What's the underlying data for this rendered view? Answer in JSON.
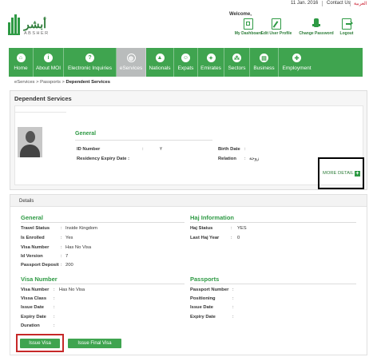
{
  "topbar": {
    "date": "11 Jan. 2016",
    "contact": "Contact Us",
    "language": "العربية"
  },
  "logo": {
    "arabic": "أبشر",
    "english": "ABSHER"
  },
  "welcome": {
    "label": "Welcome,",
    "actions": [
      {
        "label": "My Dashboard",
        "icon": "dashboard-icon"
      },
      {
        "label": "Edit User Profile",
        "icon": "edit-profile-icon"
      },
      {
        "label": "Change Password",
        "icon": "change-password-icon"
      },
      {
        "label": "Logout",
        "icon": "logout-icon"
      }
    ]
  },
  "nav": {
    "items": [
      {
        "label": "Home",
        "icon": "home-icon"
      },
      {
        "label": "About MOI",
        "icon": "about-icon"
      },
      {
        "label": "Electronic Inquiries",
        "icon": "inquiries-icon"
      },
      {
        "label": "eServices",
        "icon": "globe-icon",
        "active": true
      },
      {
        "label": "Nationals",
        "icon": "nationals-icon"
      },
      {
        "label": "Expats",
        "icon": "expats-icon"
      },
      {
        "label": "Emirates",
        "icon": "emirates-icon"
      },
      {
        "label": "Sectors",
        "icon": "sectors-icon"
      },
      {
        "label": "Business",
        "icon": "business-icon"
      },
      {
        "label": "Employment",
        "icon": "employment-icon"
      }
    ]
  },
  "breadcrumb": {
    "items": [
      "eServices",
      "Passports"
    ],
    "current": "Dependent Services",
    "separator": ">"
  },
  "dependent": {
    "title": "Dependent Services",
    "general_title": "General",
    "id_number_label": "ID Number",
    "id_number_value": "٢",
    "residency_label": "Residency Expiry Date :",
    "birth_date_label": "Birth Date",
    "relation_label": "Relation",
    "relation_value": "زوجة",
    "more_detail": "MORE DETAIL"
  },
  "details": {
    "title": "Details",
    "general": {
      "title": "General",
      "rows": [
        {
          "label": "Travel Status",
          "value": "Inside Kingdom"
        },
        {
          "label": "Is Enrolled",
          "value": "Yes"
        },
        {
          "label": "Visa Number",
          "value": "Has No Visa"
        },
        {
          "label": "Id Version",
          "value": "7"
        },
        {
          "label": "Passport Deposit",
          "value": "200"
        }
      ]
    },
    "haj": {
      "title": "Haj Information",
      "rows": [
        {
          "label": "Haj Status",
          "value": "YES"
        },
        {
          "label": "Last Haj Year",
          "value": "0"
        }
      ]
    },
    "visa": {
      "title": "Visa Number",
      "rows": [
        {
          "label": "Visa Number",
          "value": "Has No Visa"
        },
        {
          "label": "Vissa Class",
          "value": ""
        },
        {
          "label": "Issue Date",
          "value": ""
        },
        {
          "label": "Expiry Date",
          "value": ""
        },
        {
          "label": "Duration",
          "value": ""
        }
      ]
    },
    "passports": {
      "title": "Passports",
      "rows": [
        {
          "label": "Passport Number",
          "value": ""
        },
        {
          "label": "Positioning",
          "value": ""
        },
        {
          "label": "Issue Date",
          "value": ""
        },
        {
          "label": "Expiry Date",
          "value": ""
        }
      ]
    }
  },
  "buttons": {
    "issue_visa": "Issue Visa",
    "issue_final_visa": "Issue Final Visa"
  },
  "colors": {
    "brand_green": "#3fa44f",
    "nav_active": "#b9bcbc",
    "highlight_black": "#000000",
    "highlight_red": "#c62828"
  }
}
